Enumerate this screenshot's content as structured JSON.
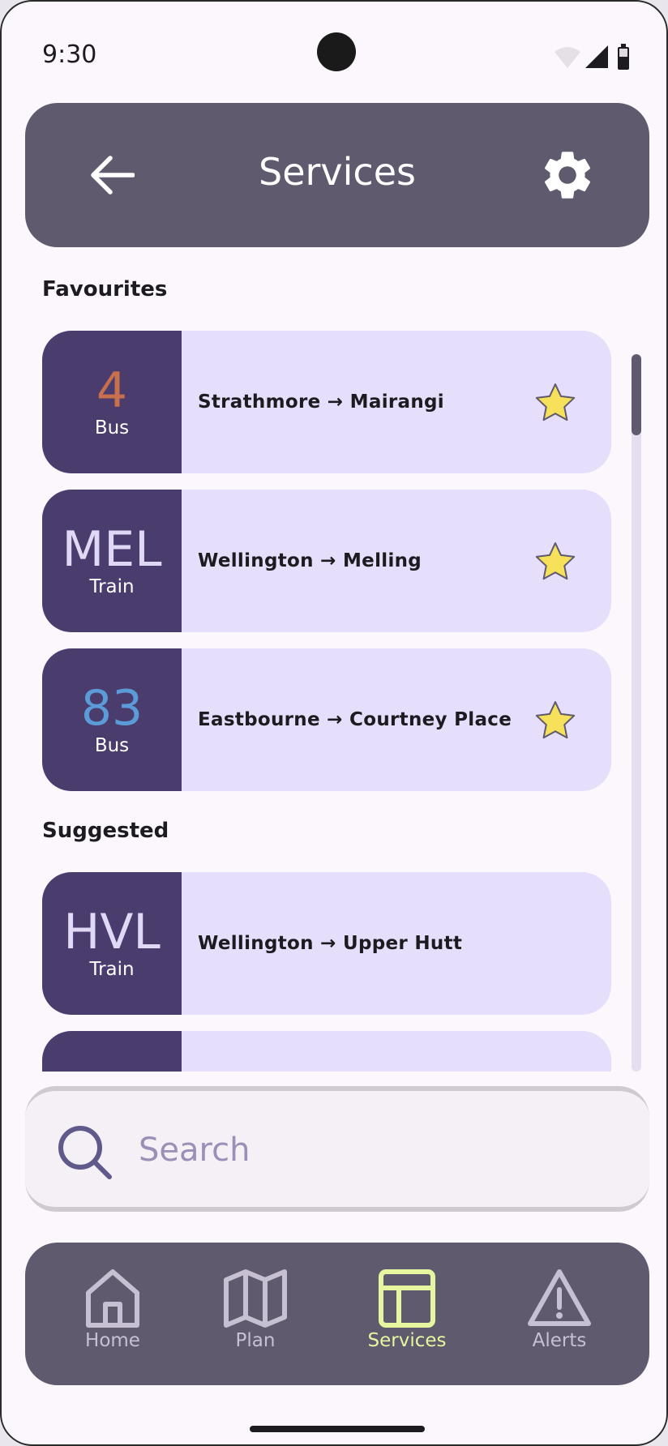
{
  "status_bar": {
    "time": "9:30"
  },
  "header": {
    "title": "Services"
  },
  "sections": {
    "favourites": "Favourites",
    "suggested": "Suggested"
  },
  "favourites": [
    {
      "code": "4",
      "mode": "Bus",
      "route": "Strathmore → Mairangi",
      "code_color": "#c8704e"
    },
    {
      "code": "MEL",
      "mode": "Train",
      "route": "Wellington → Melling",
      "code_color": "#e0d9f5"
    },
    {
      "code": "83",
      "mode": "Bus",
      "route": "Eastbourne → Courtney Place",
      "code_color": "#5b9bd8"
    }
  ],
  "suggested": [
    {
      "code": "HVL",
      "mode": "Train",
      "route": "Wellington → Upper Hutt",
      "code_color": "#e0d9f5"
    }
  ],
  "search": {
    "placeholder": "Search"
  },
  "nav": {
    "items": [
      {
        "label": "Home",
        "icon": "home-icon"
      },
      {
        "label": "Plan",
        "icon": "map-icon"
      },
      {
        "label": "Services",
        "icon": "table-icon",
        "active": true
      },
      {
        "label": "Alerts",
        "icon": "warning-icon"
      }
    ]
  },
  "colors": {
    "header_bg": "#5f5a6d",
    "badge_bg": "#4a3d6e",
    "card_bg": "#e6dffb",
    "star": "#f7e15a",
    "nav_active": "#e6f5a0",
    "nav_inactive": "#c6c0d2"
  }
}
